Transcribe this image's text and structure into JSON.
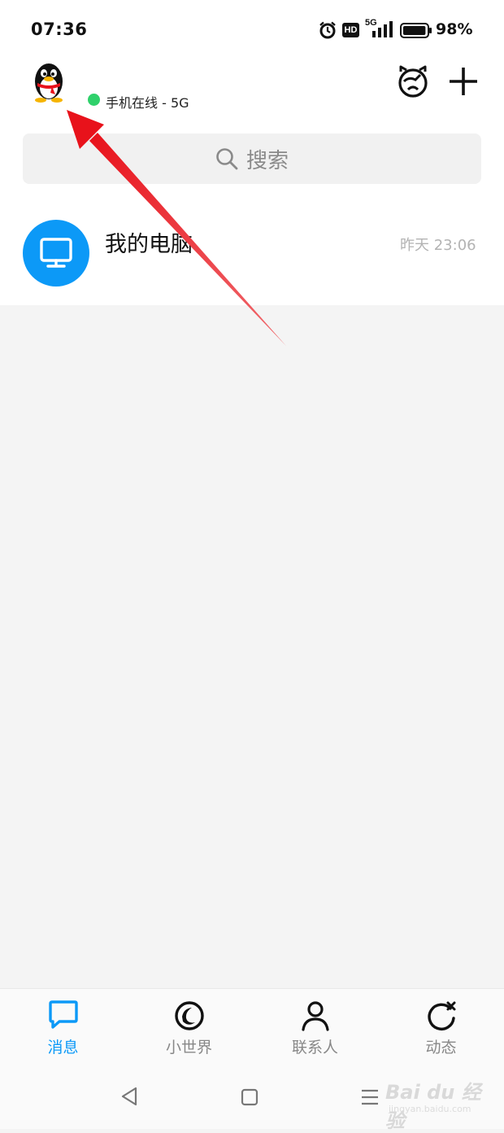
{
  "status_bar": {
    "time": "07:36",
    "network": "5G",
    "hd_label": "HD",
    "battery_percent": "98%",
    "battery_level": 0.98
  },
  "header": {
    "online_status": "手机在线 - 5G",
    "online_dot_color": "#2fd16b",
    "avatar_icon": "qq-penguin-icon",
    "right_icons": [
      "qq-show-cat-icon",
      "plus-icon"
    ]
  },
  "search": {
    "placeholder": "搜索",
    "icon": "search-icon"
  },
  "chat_list": [
    {
      "name": "我的电脑",
      "time": "昨天 23:06",
      "avatar_icon": "monitor-icon",
      "avatar_color": "#0c99f7"
    }
  ],
  "bottom_nav": {
    "tabs": [
      {
        "label": "消息",
        "icon": "message-bubble-icon",
        "active": true
      },
      {
        "label": "小世界",
        "icon": "small-world-icon",
        "active": false
      },
      {
        "label": "联系人",
        "icon": "contacts-person-icon",
        "active": false
      },
      {
        "label": "动态",
        "icon": "moments-refresh-icon",
        "active": false
      }
    ],
    "active_color": "#0c99f7"
  },
  "system_nav": [
    "back-triangle-icon",
    "home-square-icon",
    "recent-menu-icon"
  ],
  "watermark": {
    "text": "Bai du 经验",
    "subtext": "jingyan.baidu.com"
  },
  "annotation": {
    "arrow_color": "#e8121b"
  }
}
